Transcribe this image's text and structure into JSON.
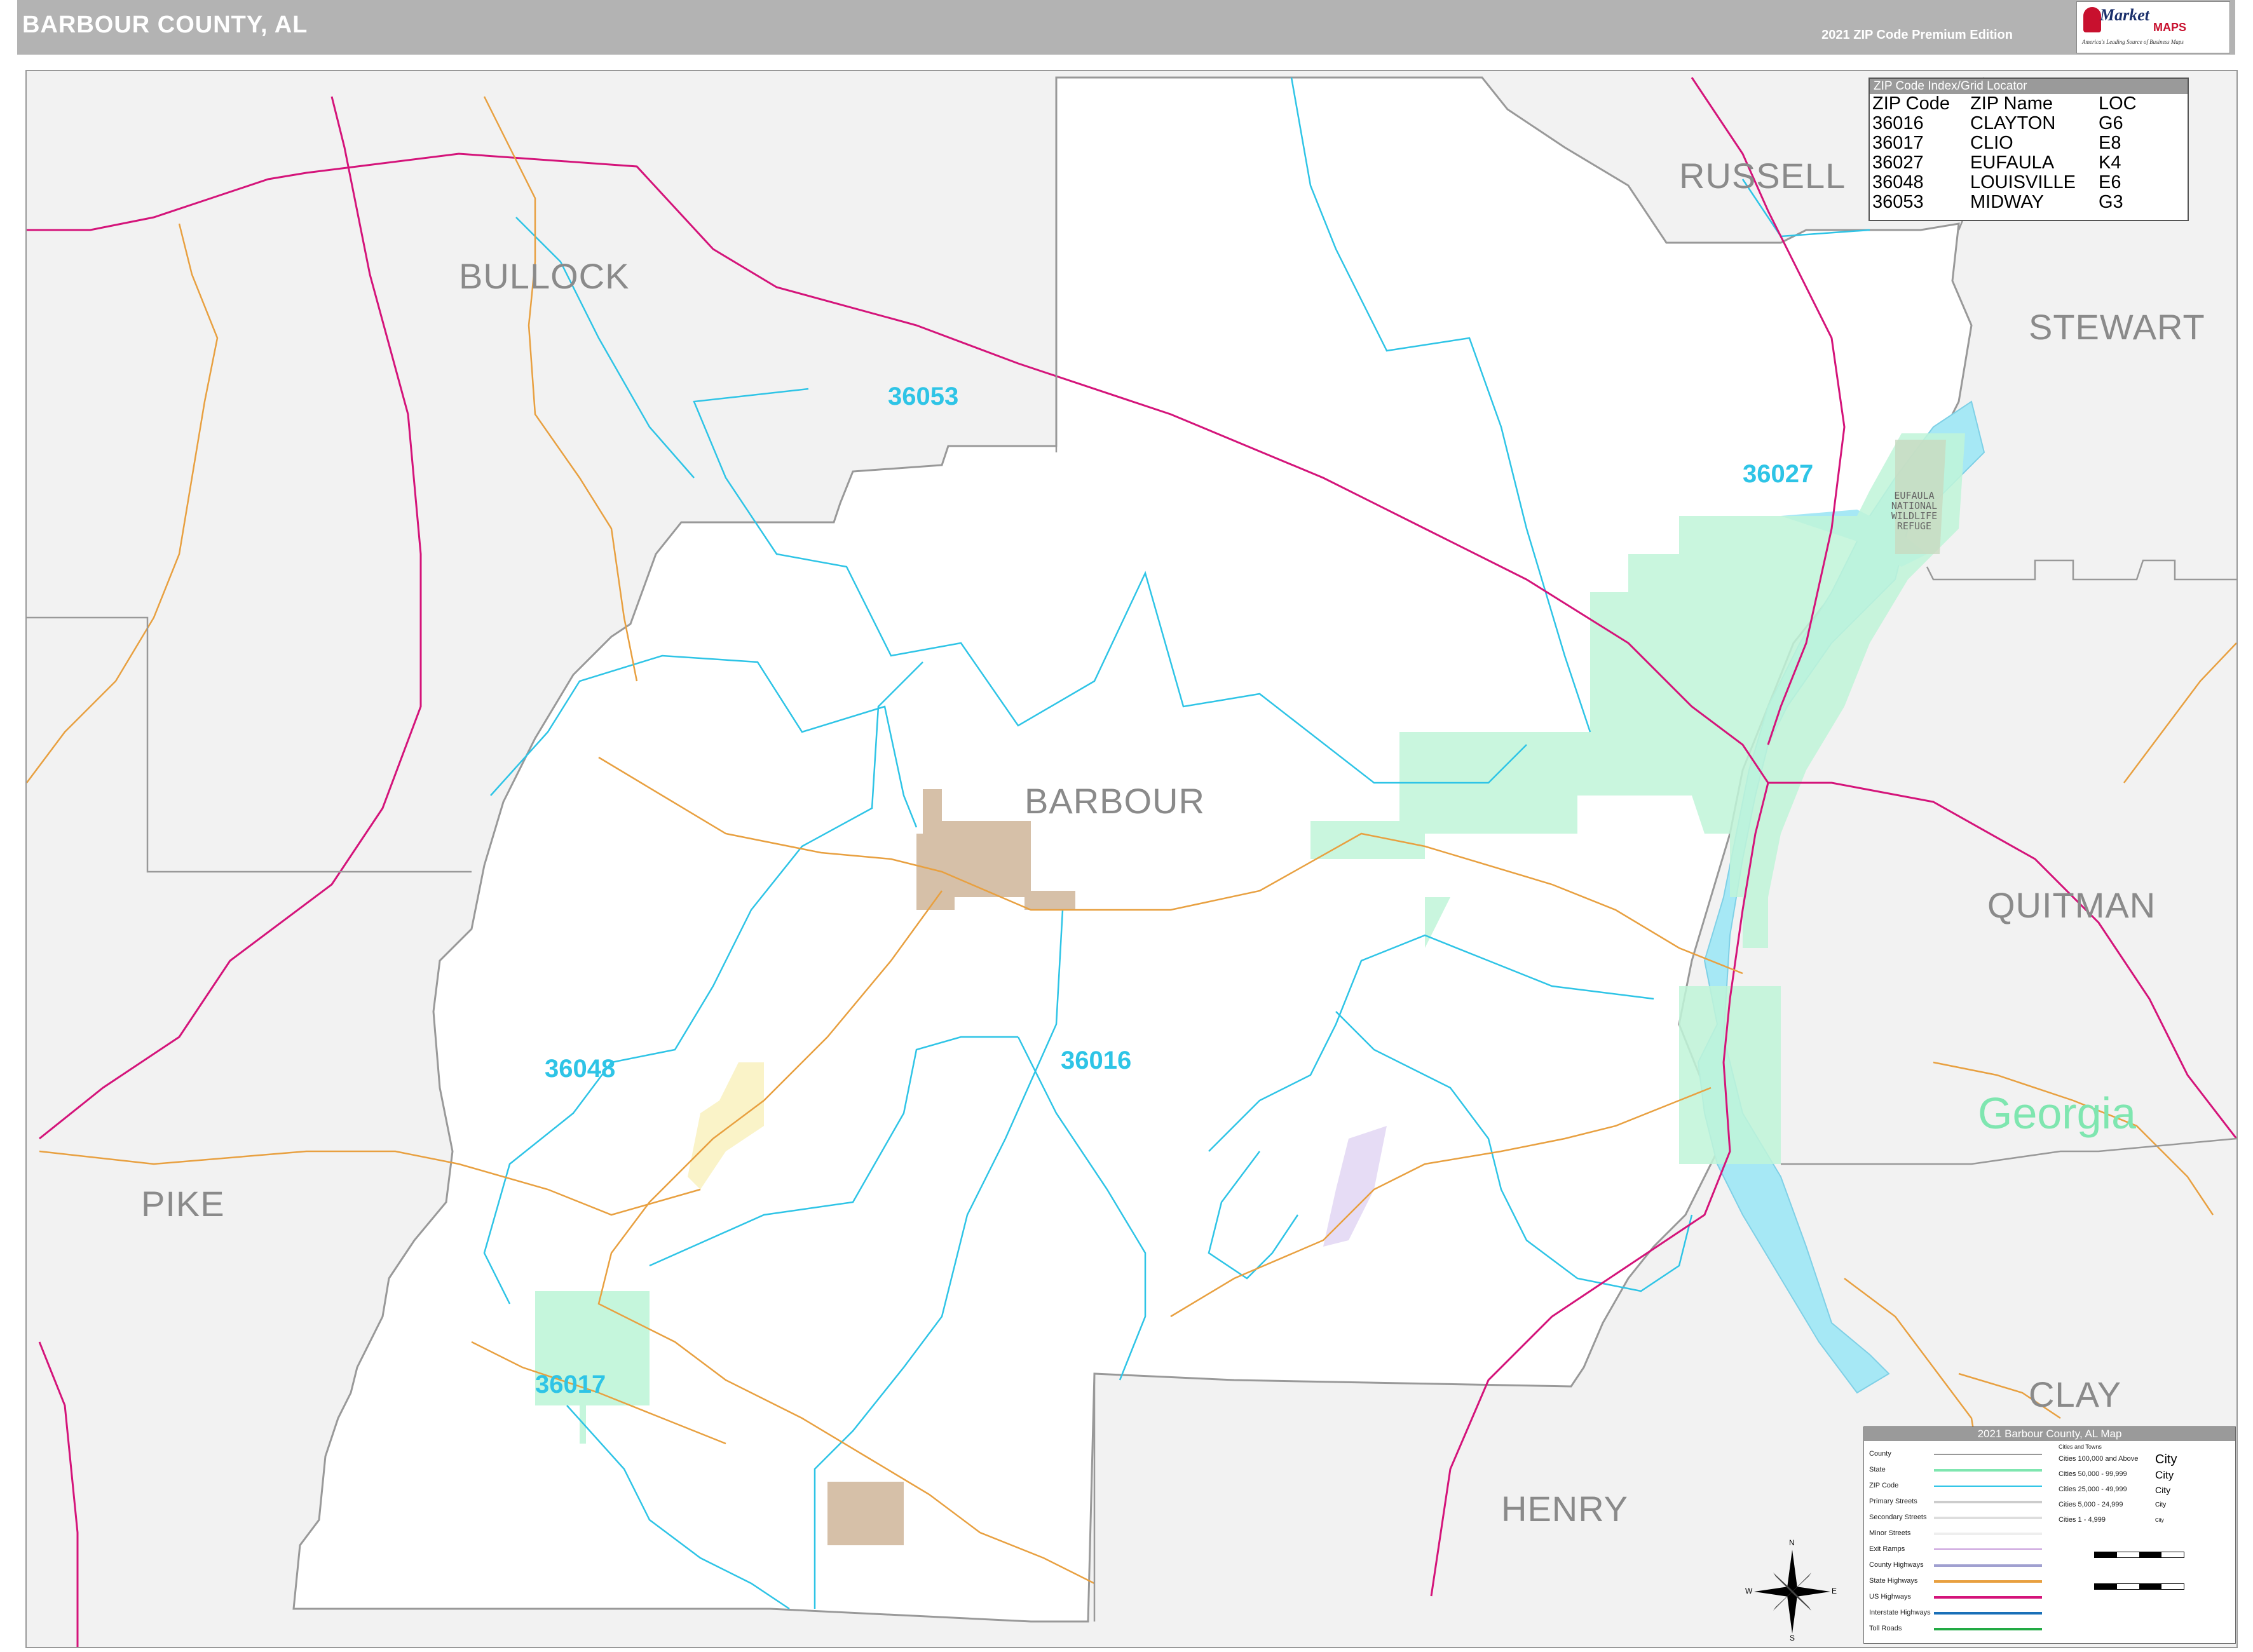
{
  "header": {
    "title": "BARBOUR COUNTY, AL",
    "edition": "2021 ZIP Code Premium Edition",
    "logo_text": "Market",
    "logo_maps": "MAPS",
    "logo_tagline": "America's Leading Source of Business Maps"
  },
  "county_labels": {
    "bullock": "BULLOCK",
    "russell": "RUSSELL",
    "stewart": "STEWART",
    "barbour": "BARBOUR",
    "quitman": "QUITMAN",
    "pike": "PIKE",
    "clay": "CLAY",
    "henry": "HENRY"
  },
  "state_label": "Georgia",
  "zip_labels": {
    "z36053": "36053",
    "z36027": "36027",
    "z36048": "36048",
    "z36016": "36016",
    "z36017": "36017"
  },
  "refuge_label": "EUFAULA\nNATIONAL\nWILDLIFE\nREFUGE",
  "zip_index": {
    "title": "ZIP Code Index/Grid Locator",
    "headers": [
      "ZIP Code",
      "ZIP Name",
      "LOC"
    ],
    "rows": [
      [
        "36016",
        "CLAYTON",
        "G6"
      ],
      [
        "36017",
        "CLIO",
        "E8"
      ],
      [
        "36027",
        "EUFAULA",
        "K4"
      ],
      [
        "36048",
        "LOUISVILLE",
        "E6"
      ],
      [
        "36053",
        "MIDWAY",
        "G3"
      ]
    ]
  },
  "legend": {
    "title": "2021 Barbour County, AL Map",
    "items": [
      "County",
      "State",
      "ZIP Code",
      "Primary Streets",
      "Secondary Streets",
      "Minor Streets",
      "Exit Ramps",
      "County Highways",
      "State Highways",
      "US Highways",
      "Interstate Highways",
      "Toll Roads"
    ],
    "cities_header": "Cities and Towns",
    "cities": [
      {
        "label": "Cities 100,000 and Above",
        "sample": "City"
      },
      {
        "label": "Cities 50,000 - 99,999",
        "sample": "City"
      },
      {
        "label": "Cities 25,000 - 49,999",
        "sample": "City"
      },
      {
        "label": "Cities 5,000 - 24,999",
        "sample": "City"
      },
      {
        "label": "Cities 1 - 4,999",
        "sample": "City"
      }
    ],
    "colors": {
      "county": "#999999",
      "state": "#7fe6b0",
      "zip": "#2ec4e6",
      "primary": "#cccccc",
      "secondary": "#dddddd",
      "minor": "#eeeeee",
      "exit": "#c9a0dc",
      "county_hwy": "#a0a0d0",
      "state_hwy": "#e8a040",
      "us_hwy": "#d4147a",
      "interstate": "#1a70b8",
      "toll": "#22aa44"
    }
  },
  "compass": {
    "n": "N",
    "s": "S",
    "e": "E",
    "w": "W"
  },
  "colors": {
    "water": "#a6e8f5",
    "zip_line": "#2ec4e6",
    "us_highway": "#d4147a",
    "state_highway": "#e8a040",
    "county_line": "#999999",
    "eufaula_zone": "#bff5d8",
    "clayton_zone": "#d6c0a8",
    "louisville_zone": "#faf3c8",
    "clio_zone": "#bff5d8",
    "midway_zone": "#e6dcf5"
  }
}
